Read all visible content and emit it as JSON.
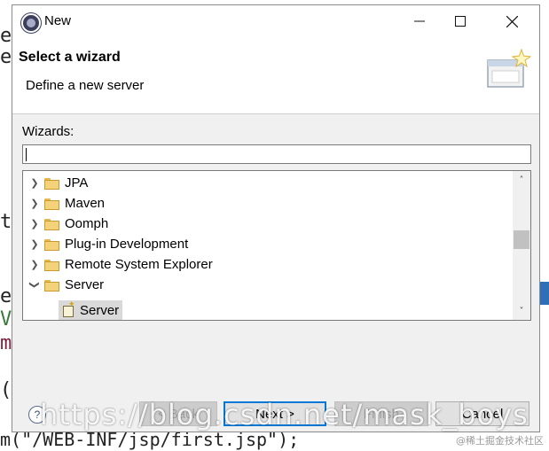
{
  "background": {
    "snippets": [
      "e",
      "e",
      "t",
      "e",
      "V",
      "m",
      "(",
      "m(\"/WEB-INF/jsp/first.jsp\");"
    ]
  },
  "dialog": {
    "title": "New",
    "header": {
      "heading": "Select a wizard",
      "description": "Define a new server"
    },
    "filter": {
      "label": "Wizards:",
      "value": ""
    },
    "tree": {
      "items": [
        {
          "label": "JPA",
          "expanded": false
        },
        {
          "label": "Maven",
          "expanded": false
        },
        {
          "label": "Oomph",
          "expanded": false
        },
        {
          "label": "Plug-in Development",
          "expanded": false
        },
        {
          "label": "Remote System Explorer",
          "expanded": false
        },
        {
          "label": "Server",
          "expanded": true
        }
      ],
      "selected_child": "Server"
    },
    "buttons": {
      "help": "?",
      "back": "< Back",
      "next": "Next >",
      "finish": "Finish",
      "cancel": "Cancel"
    }
  },
  "overlay": {
    "watermark": "https://blog.csdn.net/mask_boys",
    "badge": "@稀土掘金技术社区"
  },
  "colors": {
    "accent": "#0078d7",
    "folder": "#f4d27a",
    "selection": "#d9d9d9"
  }
}
